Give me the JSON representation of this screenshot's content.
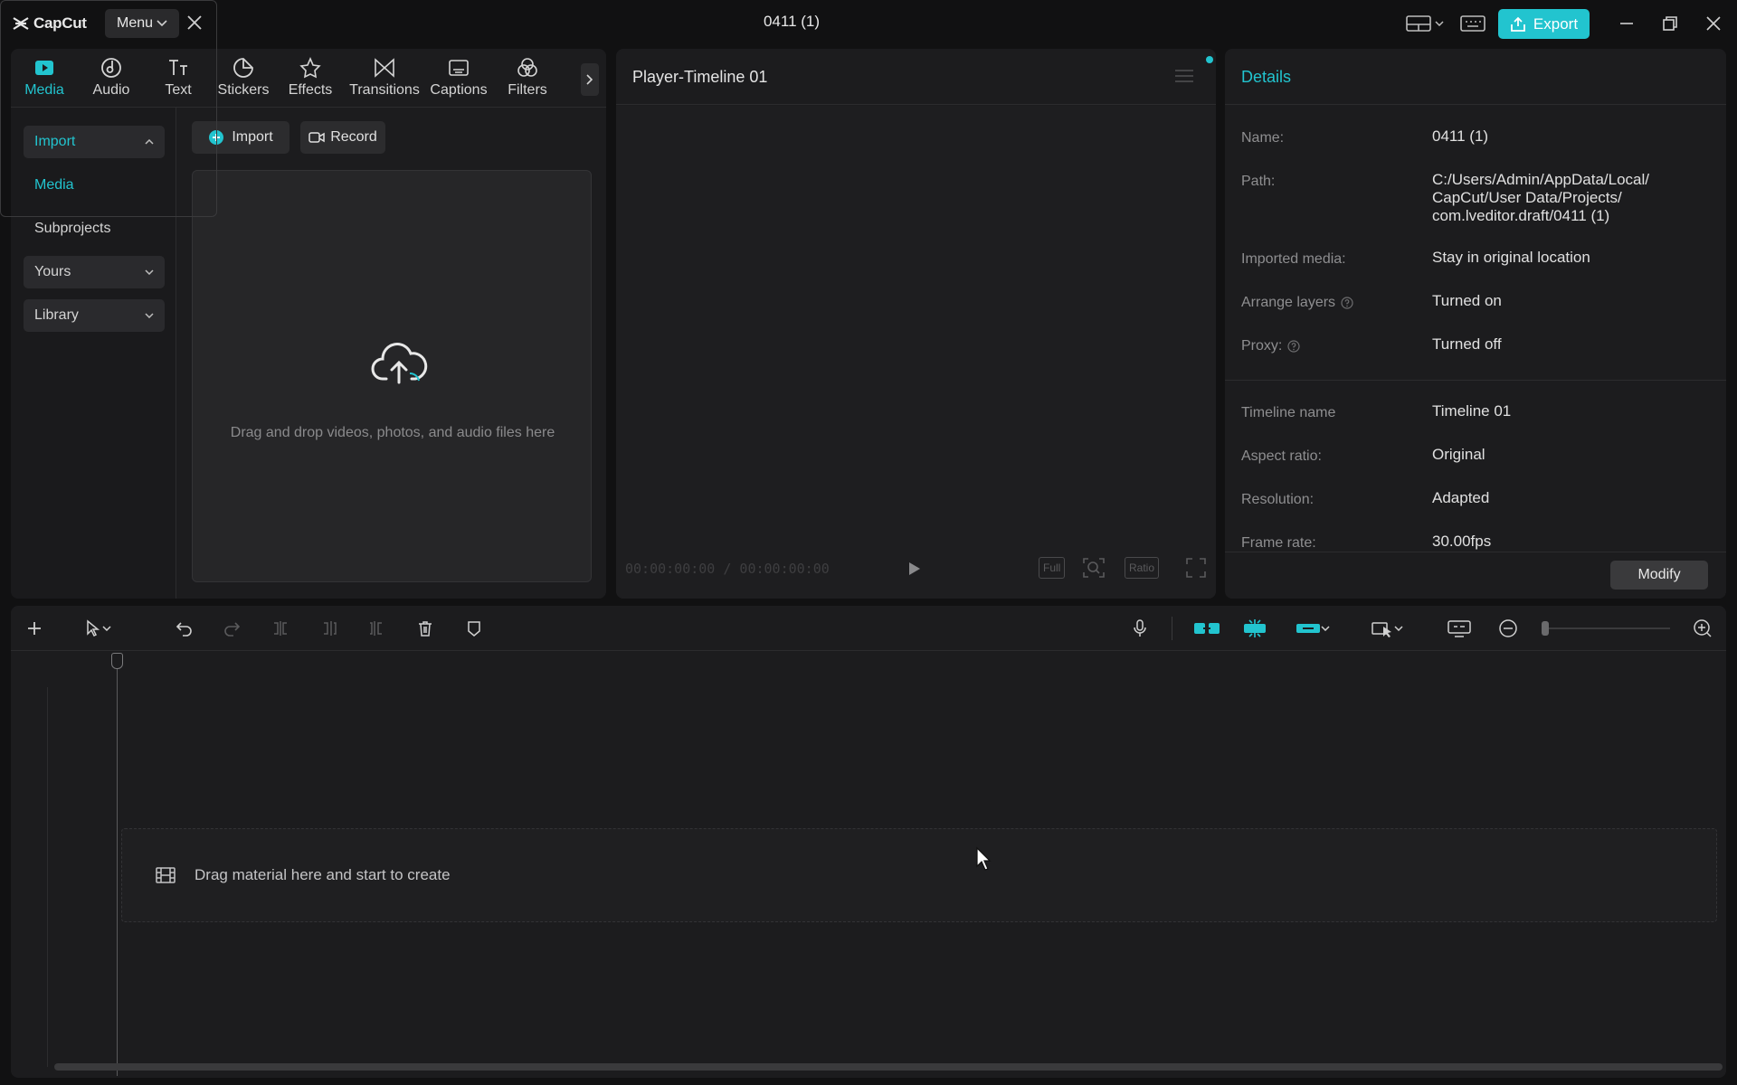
{
  "app": {
    "logo_text": "CapCut",
    "menu_label": "Menu",
    "project_title": "0411 (1)",
    "export_label": "Export"
  },
  "media_tabs": [
    {
      "label": "Media",
      "icon": "media-icon",
      "active": true
    },
    {
      "label": "Audio",
      "icon": "audio-icon"
    },
    {
      "label": "Text",
      "icon": "text-icon"
    },
    {
      "label": "Stickers",
      "icon": "stickers-icon"
    },
    {
      "label": "Effects",
      "icon": "effects-icon"
    },
    {
      "label": "Transitions",
      "icon": "transitions-icon"
    },
    {
      "label": "Captions",
      "icon": "captions-icon"
    },
    {
      "label": "Filters",
      "icon": "filters-icon"
    }
  ],
  "left_nav": {
    "import": "Import",
    "media": "Media",
    "subprojects": "Subprojects",
    "yours": "Yours",
    "library": "Library"
  },
  "media_panel": {
    "import_button": "Import",
    "record_button": "Record",
    "dropzone_text": "Drag and drop videos, photos, and audio files here"
  },
  "player": {
    "title": "Player-Timeline 01",
    "timecode": "00:00:00:00 / 00:00:00:00",
    "full_label": "Full",
    "ratio_label": "Ratio"
  },
  "details": {
    "title": "Details",
    "rows": [
      {
        "label": "Name:",
        "value": "0411 (1)"
      },
      {
        "label": "Path:",
        "value": "C:/Users/Admin/AppData/Local/ CapCut/User Data/Projects/ com.lveditor.draft/0411 (1)"
      },
      {
        "label": "Imported media:",
        "value": "Stay in original location"
      },
      {
        "label": "Arrange layers",
        "value": "Turned on"
      },
      {
        "label": "Proxy:",
        "value": "Turned off"
      },
      {
        "label": "Timeline name",
        "value": "Timeline 01"
      },
      {
        "label": "Aspect ratio:",
        "value": "Original"
      },
      {
        "label": "Resolution:",
        "value": "Adapted"
      },
      {
        "label": "Frame rate:",
        "value": "30.00fps"
      }
    ],
    "modify_button": "Modify"
  },
  "timeline": {
    "drop_text": "Drag material here and start to create"
  },
  "colors": {
    "accent": "#22c4cf",
    "background": "#111112",
    "panel": "#1c1c1e"
  }
}
